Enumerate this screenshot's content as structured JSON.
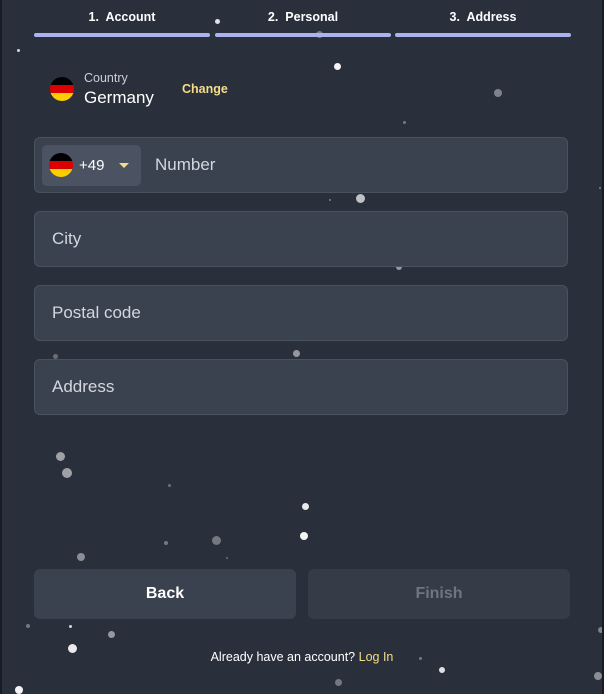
{
  "steps": [
    {
      "number": "1.",
      "label": "Account"
    },
    {
      "number": "2.",
      "label": "Personal"
    },
    {
      "number": "3.",
      "label": "Address"
    }
  ],
  "country": {
    "caption": "Country",
    "name": "Germany",
    "change_label": "Change",
    "flag_icon": "germany-flag-icon"
  },
  "phone": {
    "dial_code": "+49",
    "placeholder": "Number",
    "value": ""
  },
  "fields": {
    "city": {
      "placeholder": "City",
      "value": ""
    },
    "postal_code": {
      "placeholder": "Postal code",
      "value": ""
    },
    "address": {
      "placeholder": "Address",
      "value": ""
    }
  },
  "buttons": {
    "back": "Back",
    "finish": "Finish"
  },
  "footer": {
    "prompt": "Already have an account?",
    "link": "Log In"
  },
  "colors": {
    "accent": "#f3dd8a",
    "step_bar": "#a9b3f0",
    "panel_bg": "#2a303b",
    "field_bg": "#3a424f"
  }
}
